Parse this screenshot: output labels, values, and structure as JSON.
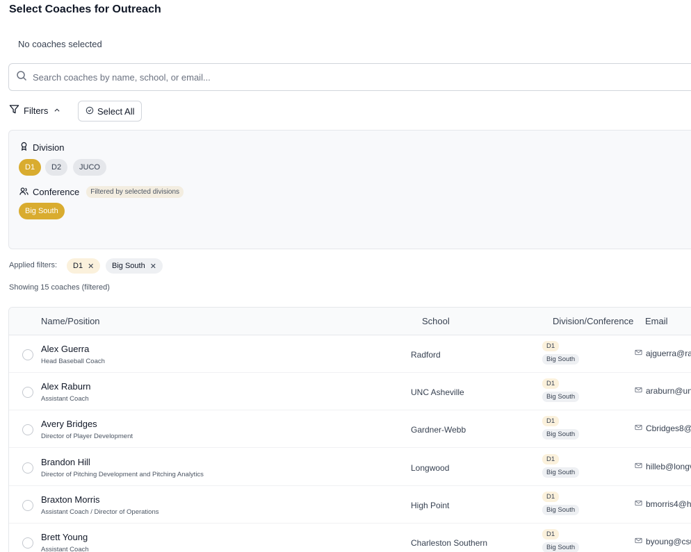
{
  "page": {
    "title": "Select Coaches for Outreach",
    "selection_status": "No coaches selected"
  },
  "search": {
    "placeholder": "Search coaches by name, school, or email..."
  },
  "toolbar": {
    "filters_label": "Filters",
    "select_all_label": "Select All"
  },
  "filter_panel": {
    "division_label": "Division",
    "divisions": [
      {
        "label": "D1",
        "selected": true
      },
      {
        "label": "D2",
        "selected": false
      },
      {
        "label": "JUCO",
        "selected": false
      }
    ],
    "conference_label": "Conference",
    "conference_hint": "Filtered by selected divisions",
    "conferences": [
      {
        "label": "Big South",
        "selected": true
      }
    ]
  },
  "applied_filters": {
    "label": "Applied filters:",
    "items": [
      "D1",
      "Big South"
    ]
  },
  "result_count": "Showing 15 coaches (filtered)",
  "table": {
    "columns": {
      "name": "Name/Position",
      "school": "School",
      "division": "Division/Conference",
      "email": "Email"
    },
    "rows": [
      {
        "name": "Alex Guerra",
        "position": "Head Baseball Coach",
        "school": "Radford",
        "division": "D1",
        "conference": "Big South",
        "email": "ajguerra@ra"
      },
      {
        "name": "Alex Raburn",
        "position": "Assistant Coach",
        "school": "UNC Asheville",
        "division": "D1",
        "conference": "Big South",
        "email": "araburn@un"
      },
      {
        "name": "Avery Bridges",
        "position": "Director of Player Development",
        "school": "Gardner-Webb",
        "division": "D1",
        "conference": "Big South",
        "email": "Cbridges8@"
      },
      {
        "name": "Brandon Hill",
        "position": "Director of Pitching Development and Pitching Analytics",
        "school": "Longwood",
        "division": "D1",
        "conference": "Big South",
        "email": "hilleb@longv"
      },
      {
        "name": "Braxton Morris",
        "position": "Assistant Coach / Director of Operations",
        "school": "High Point",
        "division": "D1",
        "conference": "Big South",
        "email": "bmorris4@h"
      },
      {
        "name": "Brett Young",
        "position": "Assistant Coach",
        "school": "Charleston Southern",
        "division": "D1",
        "conference": "Big South",
        "email": "byoung@csu"
      }
    ]
  },
  "colors": {
    "accent": "#d9ac2f",
    "chip_idle": "#e5e7eb",
    "panel_bg": "#f8f9fb"
  }
}
